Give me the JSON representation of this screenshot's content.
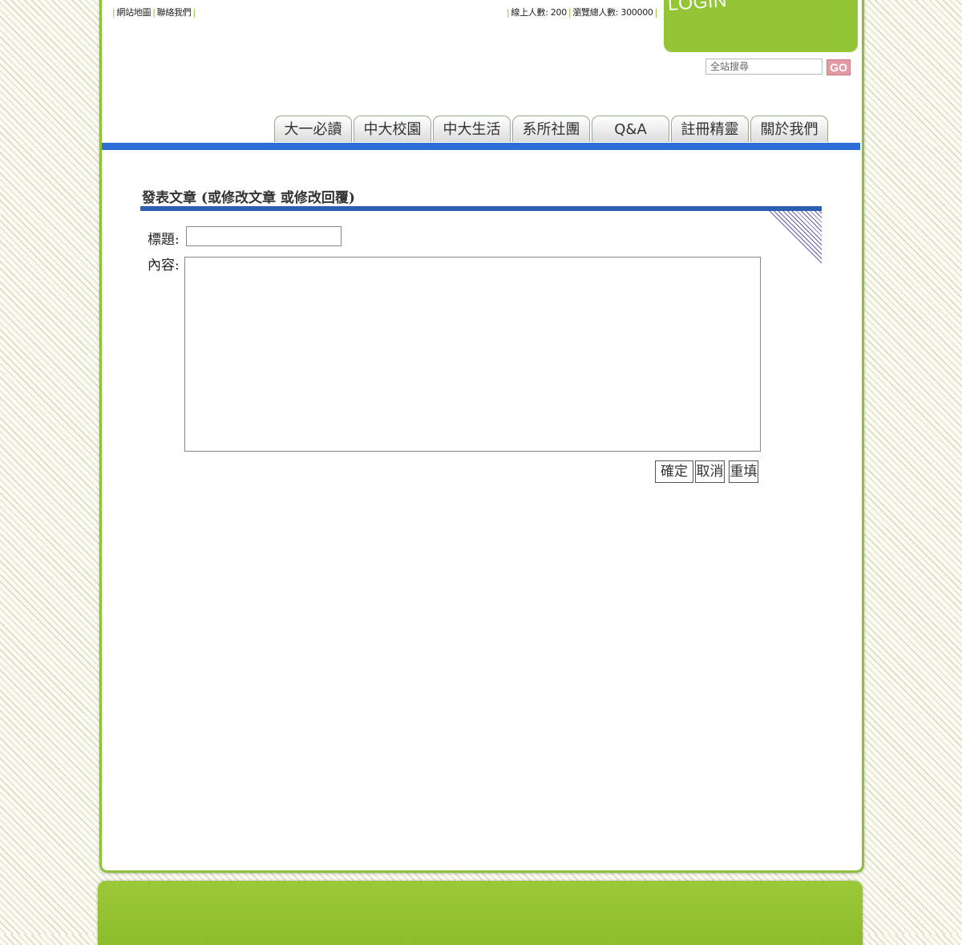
{
  "header": {
    "links": [
      "網站地圖",
      "聯絡我們"
    ],
    "stats": {
      "online_label": "線上人數: 200",
      "total_label": "瀏覽總人數: 300000"
    },
    "login_label": "LOGIN",
    "search": {
      "placeholder": "全站搜尋",
      "go_label": "GO"
    }
  },
  "nav": {
    "tabs": [
      "大一必讀",
      "中大校園",
      "中大生活",
      "系所社團",
      "Q&A",
      "註冊精靈",
      "關於我們"
    ]
  },
  "form": {
    "title": "發表文章 (或修改文章 或修改回覆)",
    "subject_label": "標題:",
    "subject_value": "",
    "content_label": "內容:",
    "content_value": "",
    "buttons": {
      "confirm": "確定",
      "cancel": "取消",
      "reset": "重填"
    }
  },
  "colors": {
    "accent_green": "#93c536",
    "nav_blue_bar": "#2d6dd6",
    "title_rule_blue": "#2d5fb0",
    "go_button": "#e39aa3"
  },
  "icons": [
    "go-icon"
  ]
}
